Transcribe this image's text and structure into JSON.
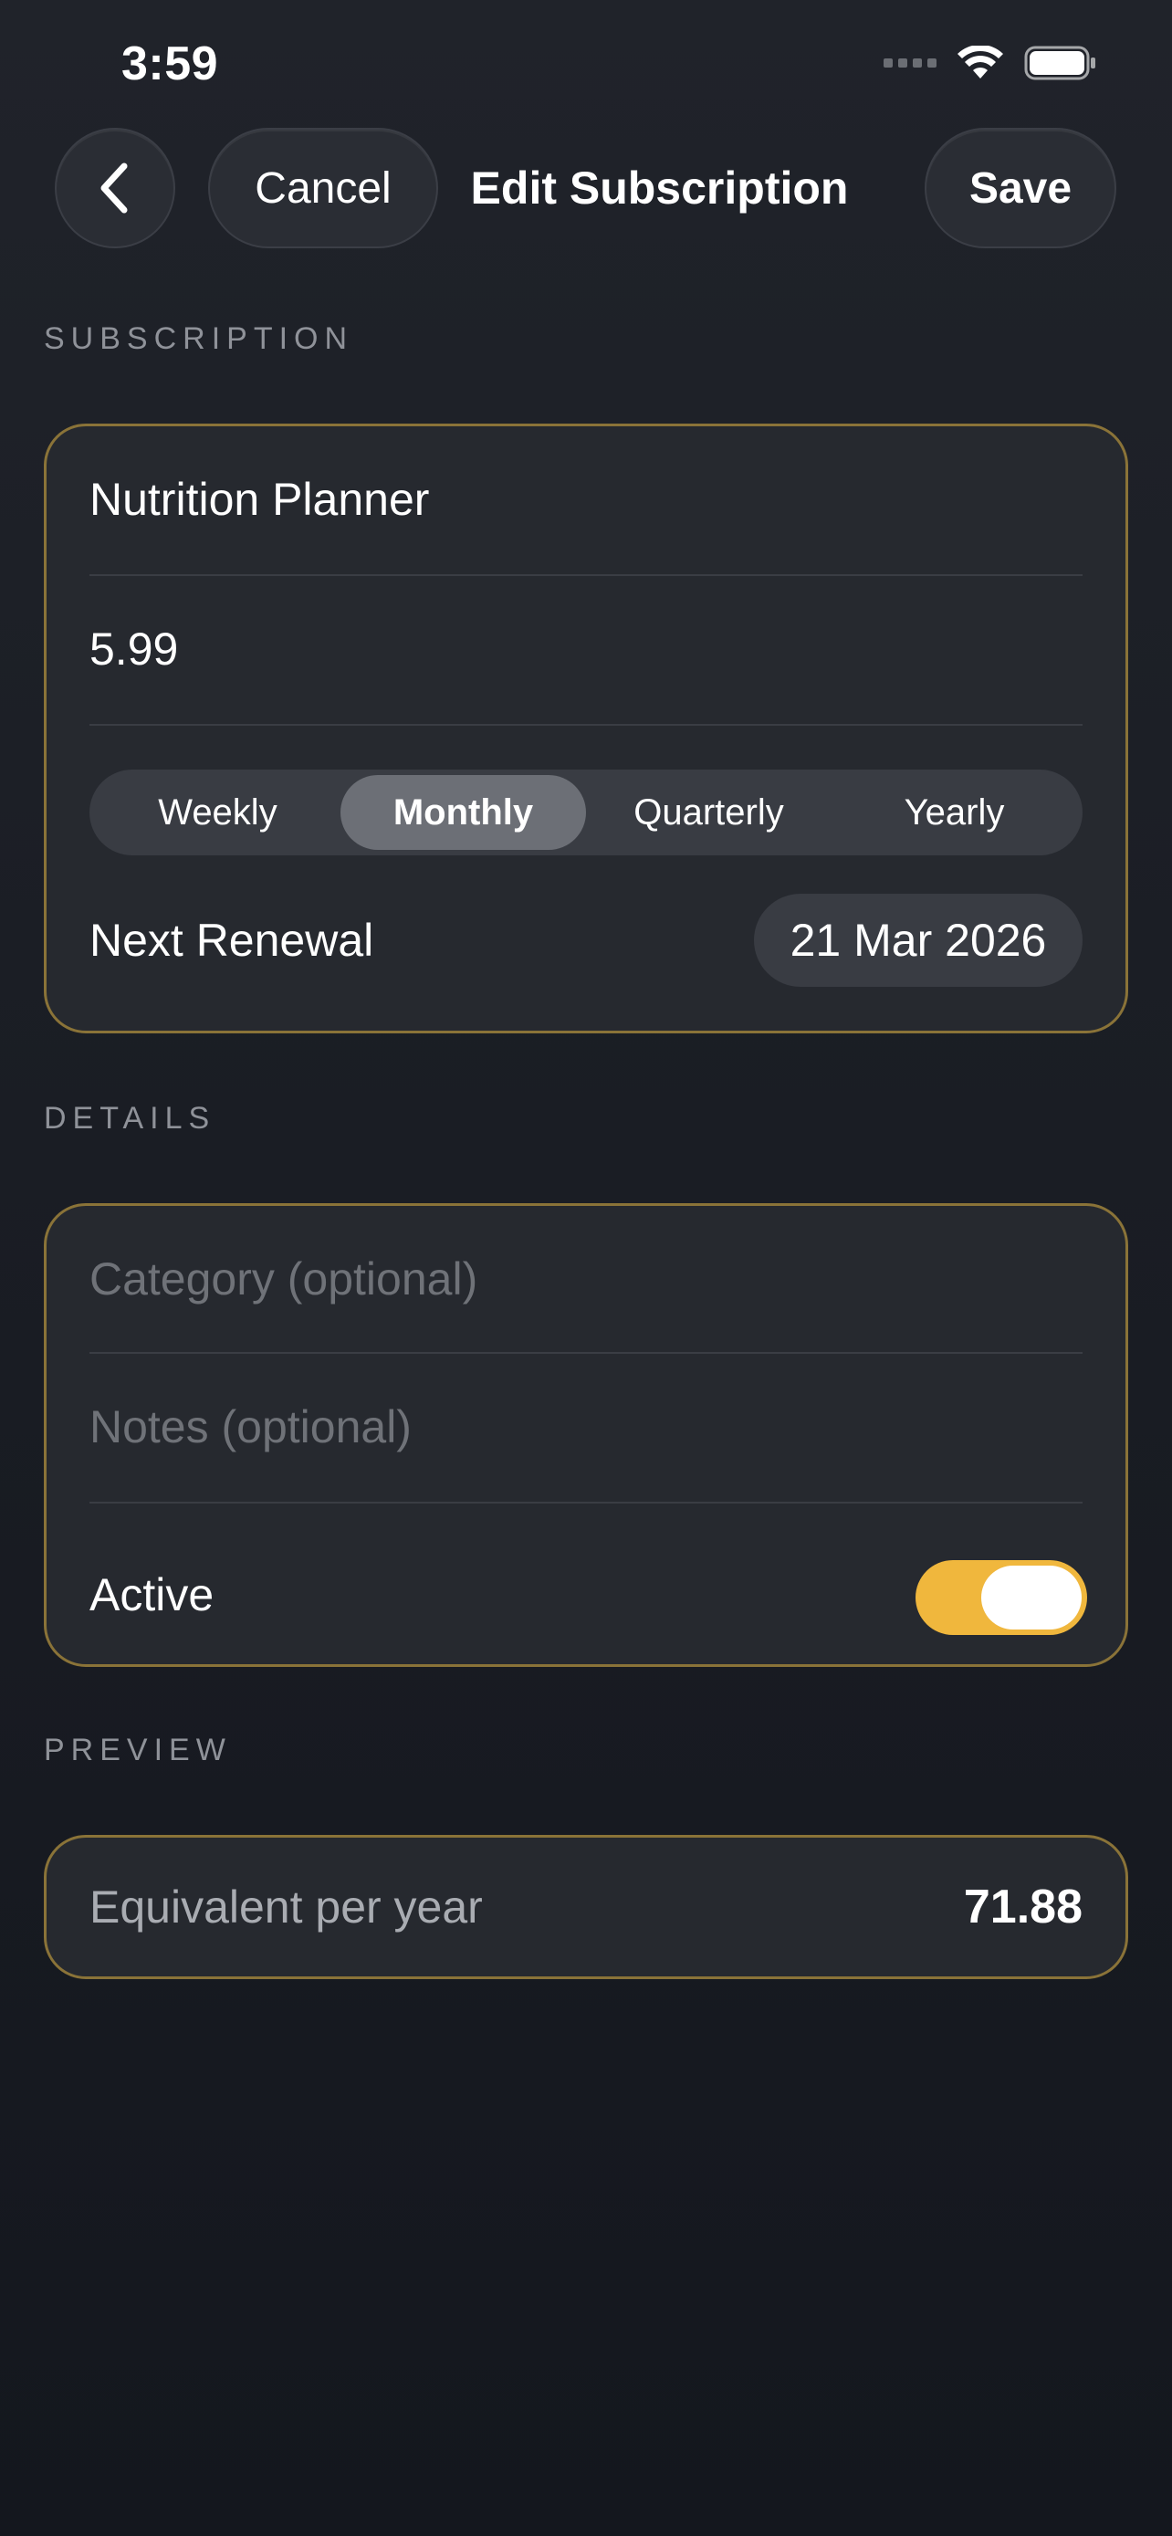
{
  "status_bar": {
    "time": "3:59"
  },
  "nav": {
    "back_icon": "chevron-left-icon",
    "cancel_label": "Cancel",
    "title": "Edit Subscription",
    "save_label": "Save"
  },
  "subscription_section": {
    "header": "SUBSCRIPTION",
    "name_value": "Nutrition Planner",
    "price_value": "5.99",
    "frequency_options": [
      "Weekly",
      "Monthly",
      "Quarterly",
      "Yearly"
    ],
    "frequency_selected": "Monthly",
    "next_renewal_label": "Next Renewal",
    "next_renewal_value": "21 Mar 2026"
  },
  "details_section": {
    "header": "DETAILS",
    "category_placeholder": "Category (optional)",
    "notes_placeholder": "Notes (optional)",
    "active_label": "Active",
    "active_on": true
  },
  "preview_section": {
    "header": "PREVIEW",
    "label": "Equivalent per year",
    "value": "71.88"
  },
  "colors": {
    "accent": "#f0b73d",
    "card_border": "#8a7338",
    "background": "#1a1d24"
  }
}
